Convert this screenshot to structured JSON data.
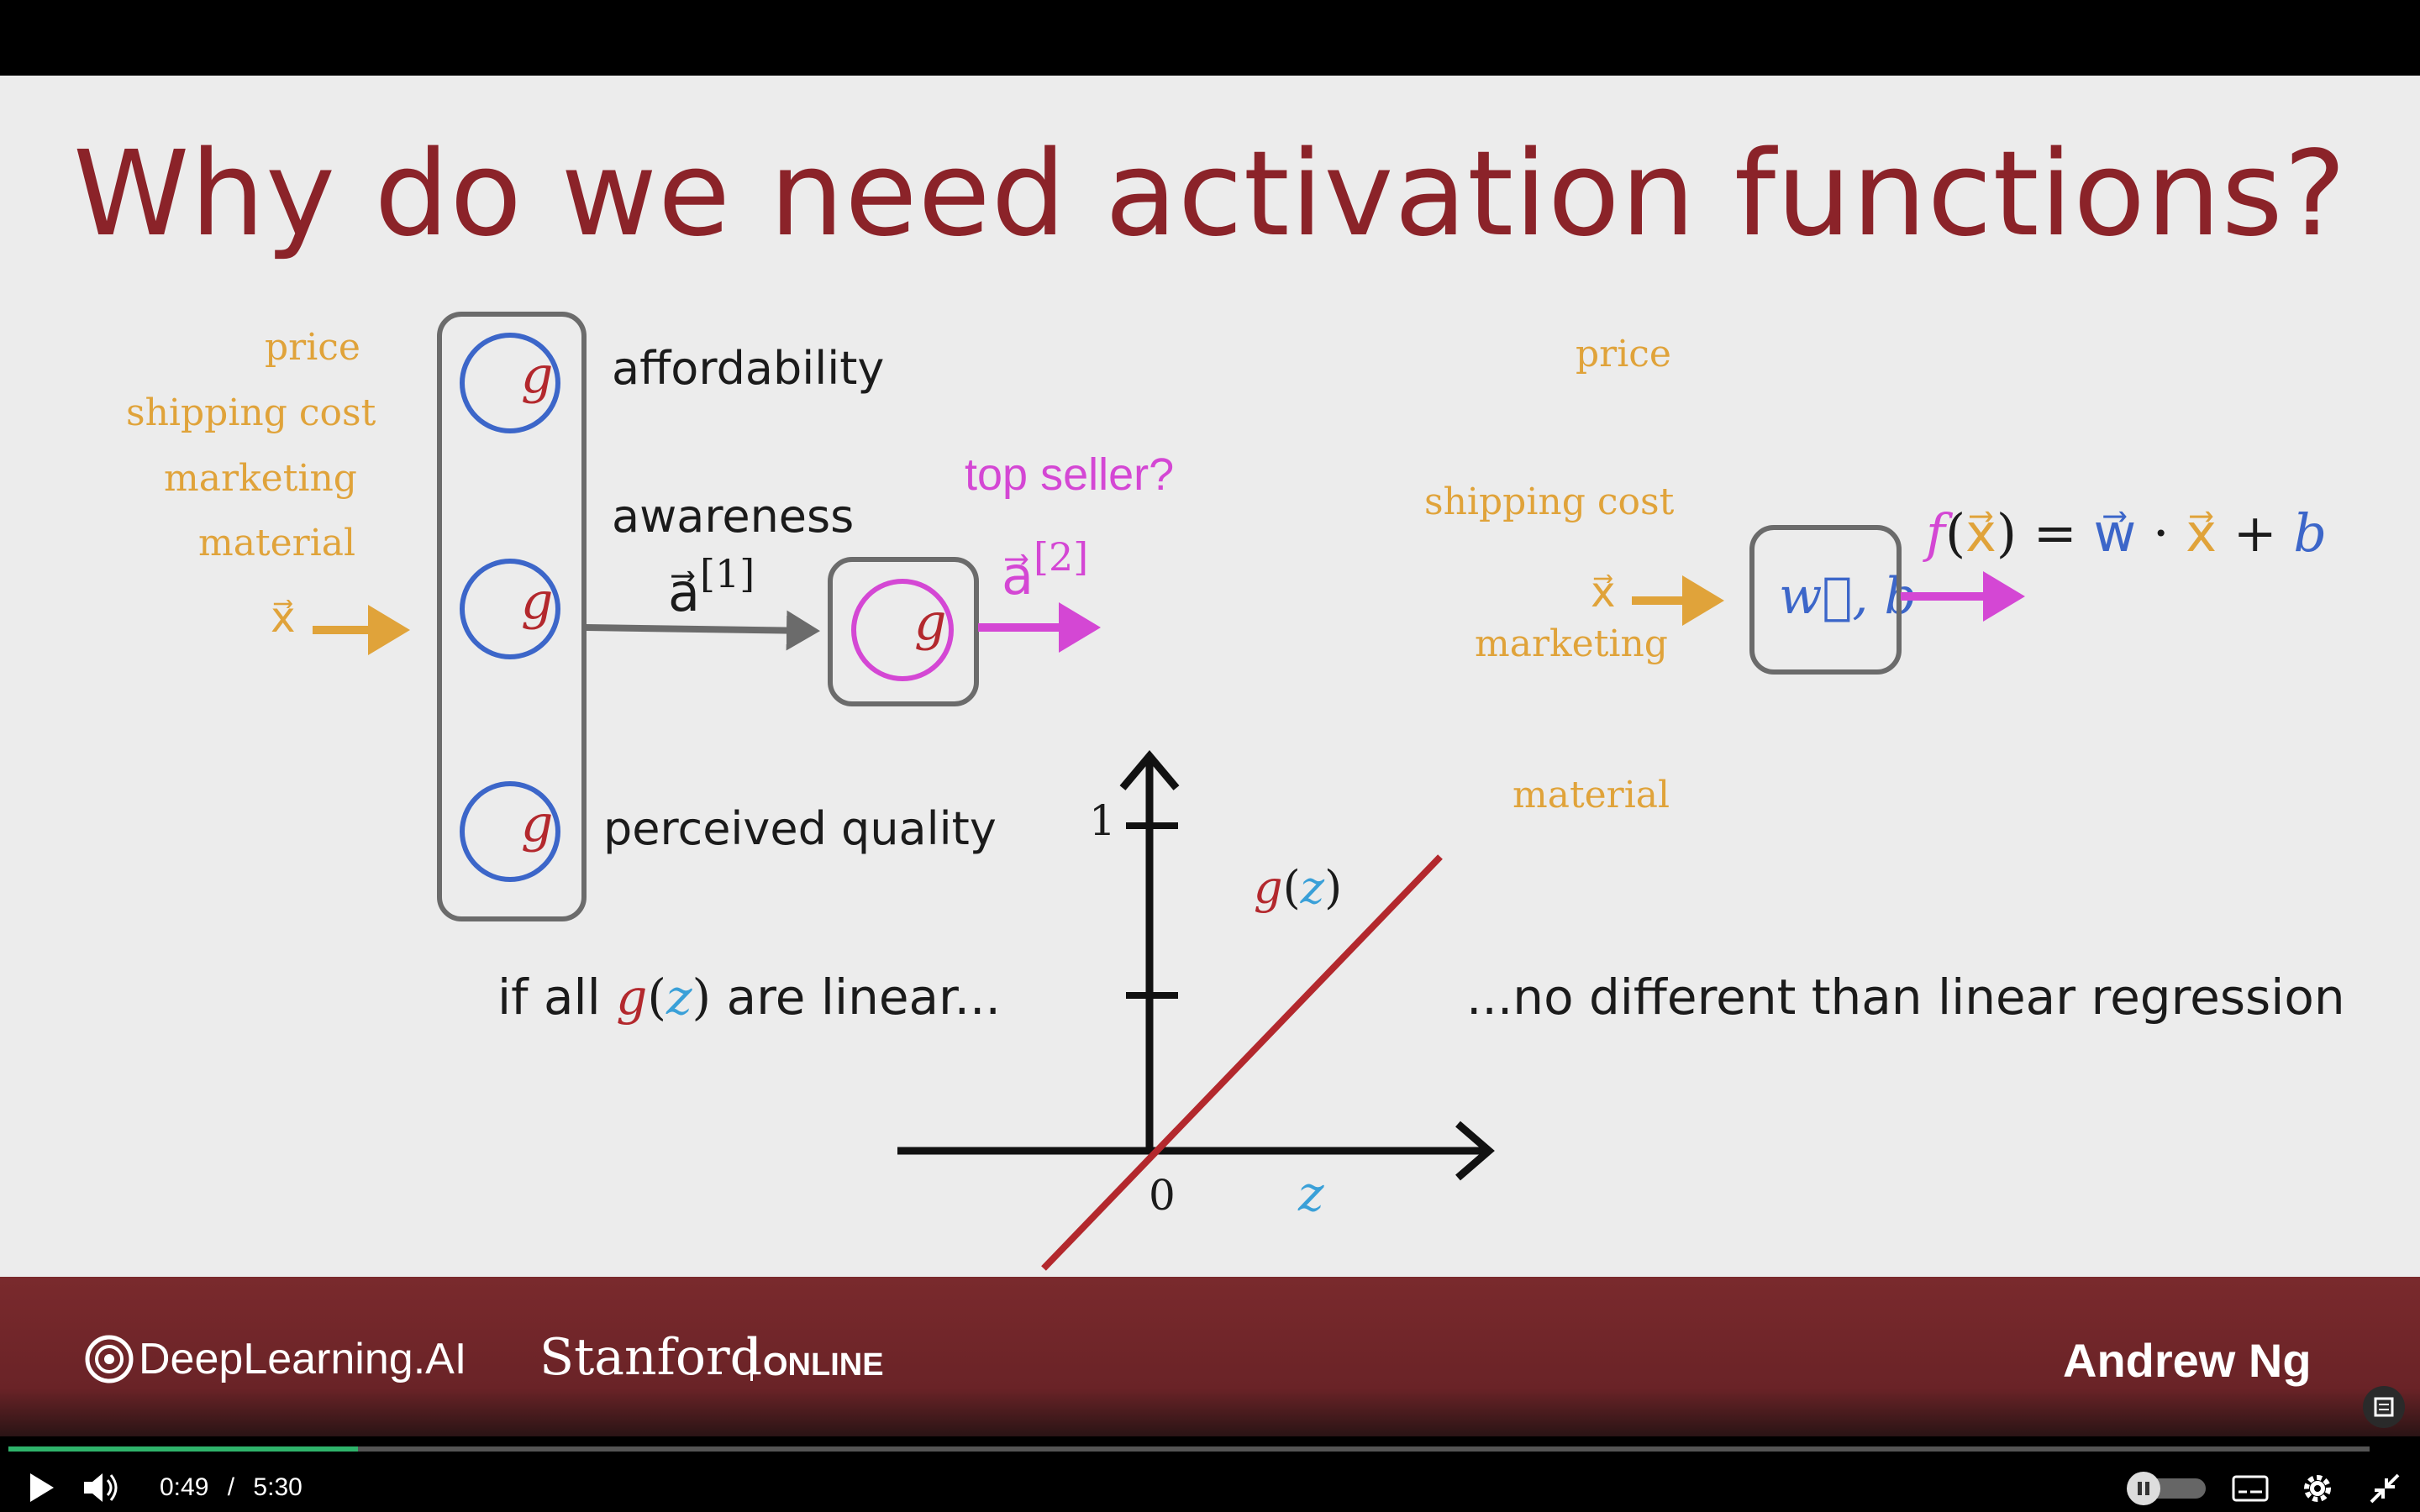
{
  "slide": {
    "title": "Why do we need activation functions?",
    "left_features": [
      "price",
      "shipping cost",
      "marketing",
      "material"
    ],
    "x_symbol": "x⃗",
    "hidden_labels": [
      "affordability",
      "awareness",
      "perceived quality"
    ],
    "neuron_symbol": "g",
    "a1_label": "a⃗",
    "a1_sup": "[1]",
    "output_label": "top seller?",
    "a2_label": "a⃗",
    "a2_sup": "[2]",
    "right_features": [
      "price",
      "shipping cost",
      "marketing",
      "material"
    ],
    "box_label": "w⃗, b",
    "formula": {
      "f": "f",
      "open": "(",
      "x": "x⃗",
      "close": ")",
      "eq": " = ",
      "w": "w⃗",
      "dot": " · ",
      "x2": "x⃗",
      "plus": " + ",
      "b": "b"
    },
    "if_text": {
      "pre": "if all ",
      "g": "g",
      "open": "(",
      "z": "z",
      "close": ")",
      "post": " are linear..."
    },
    "conclusion": "...no different than linear regression",
    "graph": {
      "y_tick_label": "1",
      "origin_label": "0",
      "x_axis_label": "z",
      "curve_label_g": "g",
      "curve_label_open": "(",
      "curve_label_z": "z",
      "curve_label_close": ")"
    }
  },
  "footer": {
    "brand_deeplearning": "DeepLearning.AI",
    "brand_stanford": "Stanford",
    "brand_online": "ONLINE",
    "presenter": "Andrew Ng"
  },
  "player": {
    "current_time": "0:49",
    "separator": "/",
    "duration": "5:30",
    "progress_fraction": 0.148
  },
  "colors": {
    "title": "#8b2329",
    "feature": "#e0a33a",
    "magenta": "#d447d4",
    "blue": "#3c66c9",
    "red_line": "#b3282d",
    "footer": "#6f2529"
  }
}
